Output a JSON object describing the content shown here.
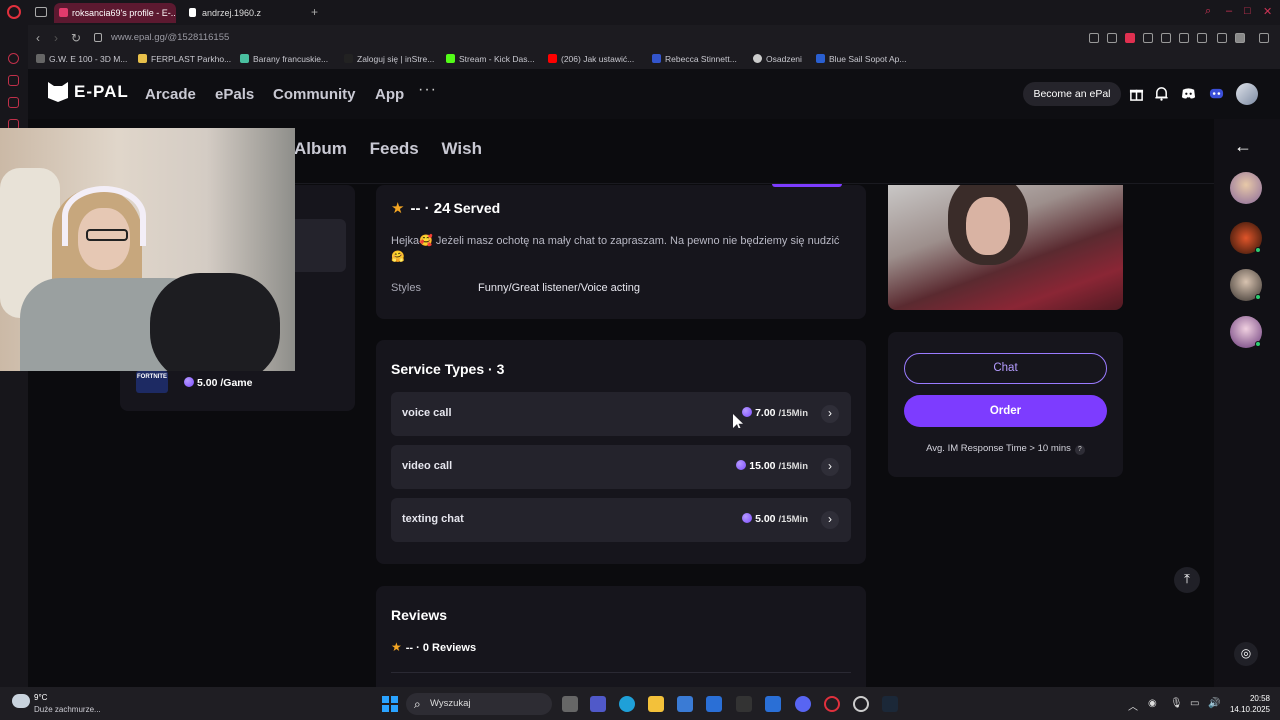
{
  "browser": {
    "tabs": [
      {
        "title": "roksancia69's profile - E-..."
      },
      {
        "title": "andrzej.1960.z"
      }
    ],
    "url": "www.epal.gg/@1528116155",
    "bookmarks": [
      "G.W. E 100 - 3D M...",
      "FERPLAST Parkho...",
      "Barany francuskie...",
      "Zaloguj się | inStre...",
      "Stream - Kick Das...",
      "(206) Jak ustawić...",
      "Rebecca Stinnett...",
      "Osadzeni",
      "Blue Sail Sopot Ap..."
    ]
  },
  "header": {
    "logo": "E-PAL",
    "nav": [
      "Arcade",
      "ePals",
      "Community",
      "App"
    ],
    "more": "···",
    "become_label": "Become an ePal",
    "icons": [
      "gift-icon",
      "bell-icon",
      "discord-icon",
      "game-icon"
    ]
  },
  "profile_tabs": [
    "Album",
    "Feeds",
    "Wish"
  ],
  "left_panel": {
    "game_badge": "FORTNITE",
    "price": "5.00 /Game"
  },
  "info": {
    "rating": "--",
    "dot": "·",
    "served_count": "24",
    "served_label": "Served",
    "bio": "Hejka🥰 Jeżeli masz ochotę na mały chat to zapraszam. Na pewno nie będziemy się nudzić 🤗",
    "styles_label": "Styles",
    "styles_value": "Funny/Great listener/Voice acting"
  },
  "services": {
    "title": "Service Types · 3",
    "items": [
      {
        "name": "voice call",
        "price": "7.00",
        "unit": "/15Min"
      },
      {
        "name": "video call",
        "price": "15.00",
        "unit": "/15Min"
      },
      {
        "name": "texting chat",
        "price": "5.00",
        "unit": "/15Min"
      }
    ]
  },
  "reviews": {
    "title": "Reviews",
    "summary": "-- · 0 Reviews"
  },
  "cta": {
    "chat_label": "Chat",
    "order_label": "Order",
    "response": "Avg. IM Response Time > 10 mins",
    "help": "?"
  },
  "taskbar": {
    "temp": "9°C",
    "weather": "Duże zachmurze...",
    "search_placeholder": "Wyszukaj",
    "time": "20:58",
    "date": "14.10.2025"
  },
  "colors": {
    "accent": "#7d3cff",
    "star": "#f5a623",
    "card": "#16151c"
  }
}
